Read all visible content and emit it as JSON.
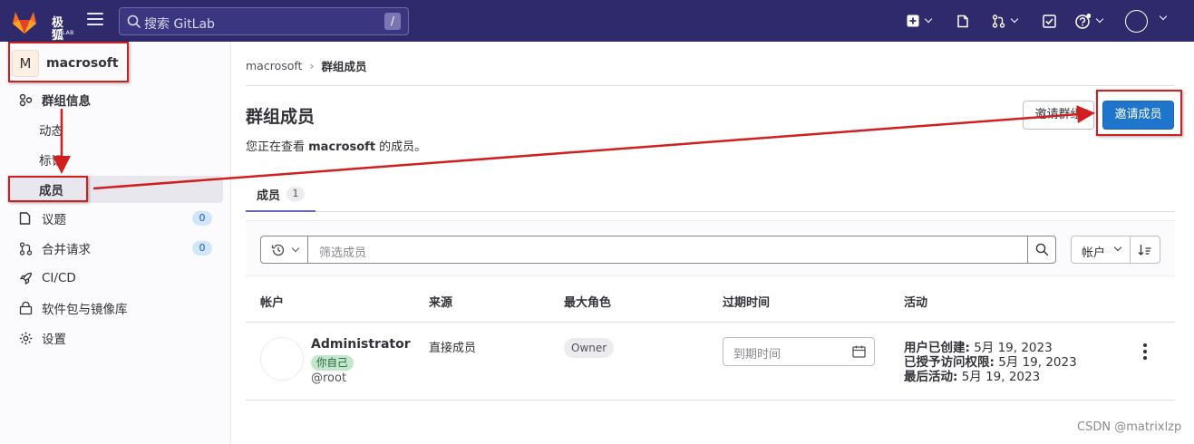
{
  "topbar": {
    "brand": "极狐",
    "brand_sub": "GITLAB",
    "search_placeholder": "搜索 GitLab",
    "search_shortcut": "/",
    "icons": [
      "plus-square-icon",
      "issues-icon",
      "merge-request-icon",
      "todo-icon",
      "help-icon",
      "user-avatar-icon"
    ]
  },
  "sidebar": {
    "group_avatar": "M",
    "group_name": "macrosoft",
    "items": [
      {
        "label": "群组信息",
        "icon": "group-info-icon"
      },
      {
        "label": "动态"
      },
      {
        "label": "标记"
      },
      {
        "label": "成员",
        "active": true
      },
      {
        "label": "议题",
        "icon": "issues-icon",
        "count": "0"
      },
      {
        "label": "合并请求",
        "icon": "merge-request-icon",
        "count": "0"
      },
      {
        "label": "CI/CD",
        "icon": "rocket-icon"
      },
      {
        "label": "软件包与镜像库",
        "icon": "package-icon"
      },
      {
        "label": "设置",
        "icon": "gear-icon"
      }
    ]
  },
  "breadcrumb": {
    "items": [
      "macrosoft",
      "群组成员"
    ],
    "separator": "›"
  },
  "header": {
    "title": "群组成员",
    "desc_prefix": "您正在查看 ",
    "desc_group": "macrosoft",
    "desc_suffix": " 的成员。",
    "invite_group_button": "邀请群组",
    "invite_member_button": "邀请成员"
  },
  "tabs": [
    {
      "label": "成员",
      "count": "1"
    }
  ],
  "filter": {
    "placeholder": "筛选成员",
    "sort_label": "帐户"
  },
  "table": {
    "columns": [
      "帐户",
      "来源",
      "最大角色",
      "过期时间",
      "活动"
    ],
    "rows": [
      {
        "name": "Administrator",
        "you_badge": "你自己",
        "handle": "@root",
        "source": "直接成员",
        "role": "Owner",
        "expiration_placeholder": "到期时间",
        "activity": {
          "created_label": "用户已创建:",
          "created": "5月 19, 2023",
          "granted_label": "已授予访问权限:",
          "granted": "5月 19, 2023",
          "last_label": "最后活动:",
          "last": "5月 19, 2023"
        }
      }
    ]
  },
  "watermark": "CSDN @matrixlzp",
  "colors": {
    "topbar": "#2f2a6b",
    "primary": "#1f75cb",
    "annotation": "#d11f1f"
  }
}
